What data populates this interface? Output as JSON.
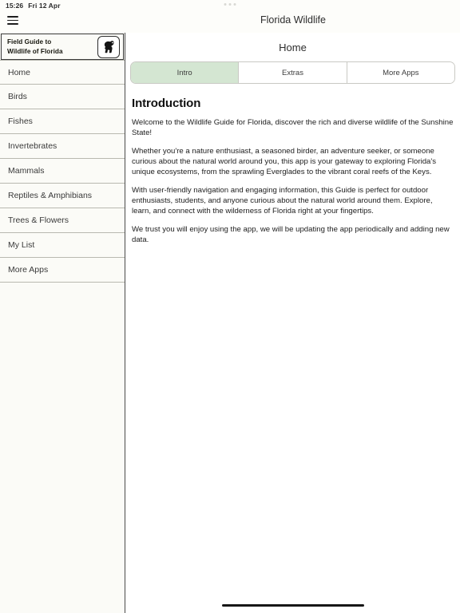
{
  "status_bar": {
    "time": "15:26",
    "date": "Fri 12 Apr",
    "multitask_indicator": "three-dots"
  },
  "top_bar": {
    "menu_icon": "hamburger-menu-icon",
    "app_title": "Florida Wildlife"
  },
  "sidebar": {
    "brand": {
      "line1": "Field Guide to",
      "line2": "Wildlife of Florida",
      "logo_icon": "panther-logo-icon"
    },
    "items": [
      {
        "label": "Home",
        "selected": true
      },
      {
        "label": "Birds",
        "selected": false
      },
      {
        "label": "Fishes",
        "selected": false
      },
      {
        "label": "Invertebrates",
        "selected": false
      },
      {
        "label": "Mammals",
        "selected": false
      },
      {
        "label": "Reptiles & Amphibians",
        "selected": false
      },
      {
        "label": "Trees & Flowers",
        "selected": false
      },
      {
        "label": "My List",
        "selected": false
      },
      {
        "label": "More Apps",
        "selected": false
      }
    ]
  },
  "main": {
    "page_title": "Home",
    "tabs": [
      {
        "label": "Intro",
        "selected": true
      },
      {
        "label": "Extras",
        "selected": false
      },
      {
        "label": "More Apps",
        "selected": false
      }
    ],
    "article": {
      "heading": "Introduction",
      "paragraphs": [
        "Welcome to the Wildlife Guide for Florida, discover the rich and diverse wildlife of the Sunshine State!",
        "Whether you're a nature enthusiast, a seasoned birder, an adventure seeker, or someone curious about the natural world around you, this app is your gateway to exploring Florida's unique ecosystems, from the sprawling Everglades to the vibrant coral reefs of the Keys.",
        "With user-friendly navigation and engaging information, this Guide is perfect for outdoor enthusiasts, students, and anyone curious about the natural world around them. Explore, learn, and connect with the wilderness of Florida right at your fingertips.",
        "We trust you will enjoy using the app, we will be updating the app periodically and adding new data."
      ]
    }
  },
  "colors": {
    "accent_selected_tab": "#d4e6d2",
    "sidebar_background": "#fbfbf7",
    "main_background": "#ffffff",
    "border": "#b9b9b0"
  },
  "home_indicator": "home-bar"
}
